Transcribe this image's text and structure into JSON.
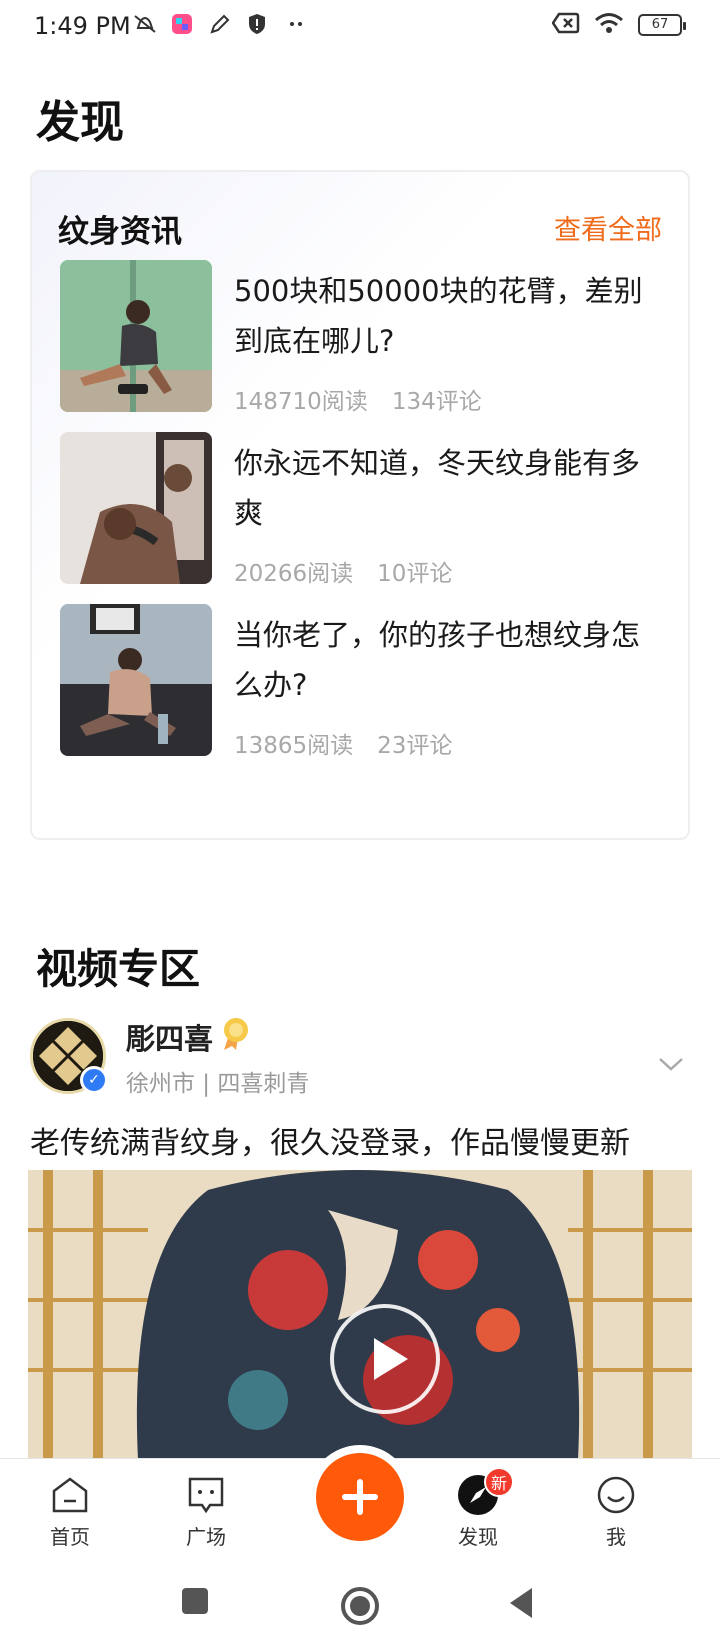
{
  "status_bar": {
    "time": "1:49 PM",
    "battery": "67"
  },
  "page": {
    "title": "发现"
  },
  "news": {
    "title": "纹身资讯",
    "view_all": "查看全部",
    "articles": [
      {
        "title": "500块和50000块的花臂，差别到底在哪儿?",
        "reads": "148710阅读",
        "comments": "134评论"
      },
      {
        "title": "你永远不知道，冬天纹身能有多爽",
        "reads": "20266阅读",
        "comments": "10评论"
      },
      {
        "title": "当你老了，你的孩子也想纹身怎么办?",
        "reads": "13865阅读",
        "comments": "23评论"
      }
    ]
  },
  "video_section": {
    "title": "视频专区",
    "post": {
      "author": "彫四喜",
      "location": "徐州市 | 四喜刺青",
      "text": "老传统满背纹身，很久没登录，作品慢慢更新"
    }
  },
  "bottom_nav": {
    "items": [
      {
        "label": "首页"
      },
      {
        "label": "广场"
      },
      {
        "label": "发现",
        "badge": "新"
      },
      {
        "label": "我"
      }
    ]
  },
  "colors": {
    "accent": "#ff5a0a",
    "link": "#ef6c1c",
    "verified": "#2f7bf5",
    "badge": "#f23a2c"
  }
}
